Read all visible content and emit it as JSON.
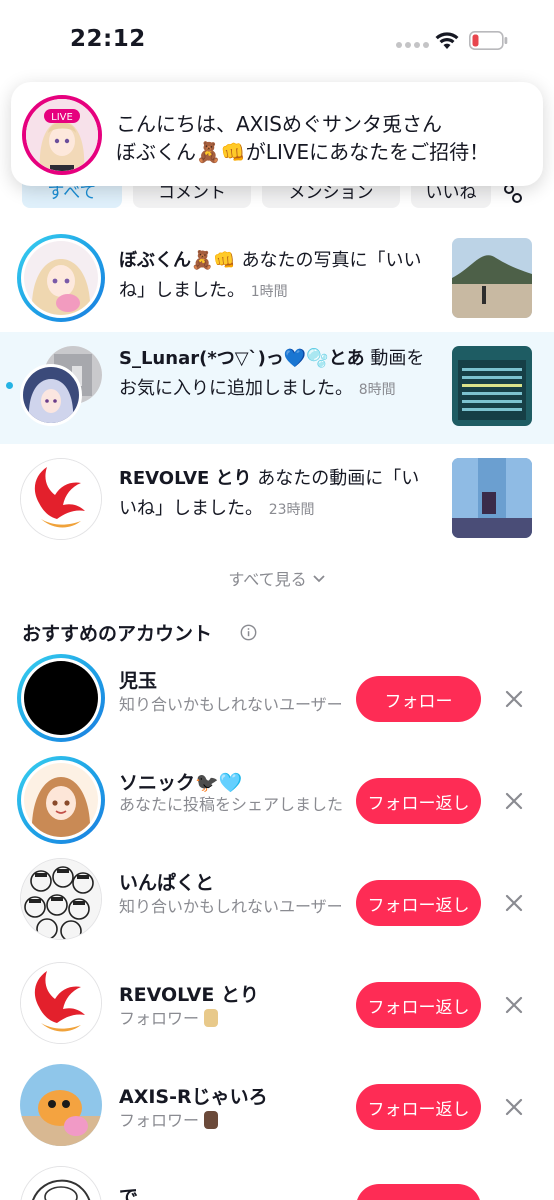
{
  "status_bar": {
    "time": "22:12",
    "battery_color": "#e8464e"
  },
  "live_banner": {
    "avatar_badge": "LIVE",
    "line1": "こんにちは、AXISめぐサンタ兎さん",
    "line2": "ぼぶくん🧸👊がLIVEにあなたをご招待！"
  },
  "tabs": [
    "すべて",
    "コメント",
    "メンション",
    "いいね"
  ],
  "notifications": [
    {
      "name": "ぼぶくん🧸👊",
      "text": "あなたの写真に「いいね」しました。",
      "time": "1時間",
      "unread": false
    },
    {
      "name": "S_Lunar(*つ▽`)っ💙🫧とあ",
      "text": "動画をお気に入りに追加しました。",
      "time": "8時間",
      "unread": true
    },
    {
      "name": "REVOLVE とり",
      "text": "あなたの動画に「いいね」しました。",
      "time": "23時間",
      "unread": false
    }
  ],
  "see_all": "すべて見る",
  "suggested": {
    "title": "おすすめのアカウント",
    "accounts": [
      {
        "name": "児玉",
        "subtitle": "知り合いかもしれないユーザー",
        "button": "フォロー"
      },
      {
        "name": "ソニック🐦‍⬛🩵",
        "subtitle": "あなたに投稿をシェアしました",
        "button": "フォロー返し"
      },
      {
        "name": "いんぱくと",
        "subtitle": "知り合いかもしれないユーザー",
        "button": "フォロー返し"
      },
      {
        "name": "REVOLVE とり",
        "subtitle": "フォロワー",
        "button": "フォロー返し"
      },
      {
        "name": "AXIS-Rじゃいろ",
        "subtitle": "フォロワー",
        "button": "フォロー返し"
      },
      {
        "name": "で",
        "subtitle": "",
        "button": ""
      }
    ]
  },
  "colors": {
    "accent": "#fe2c55",
    "unread_bg": "#eef8fd",
    "ring": "#1fa3e6"
  }
}
